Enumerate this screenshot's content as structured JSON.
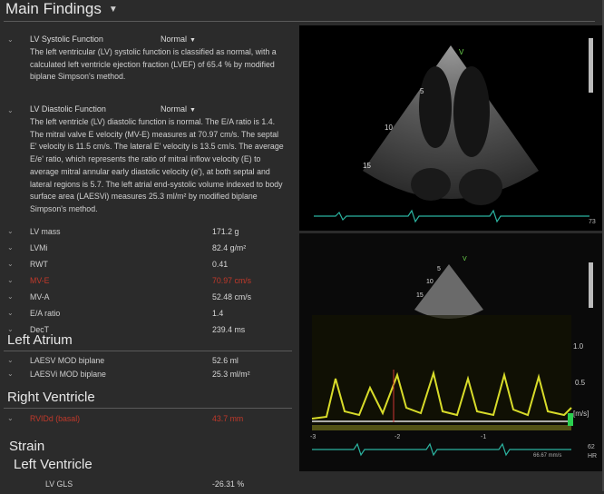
{
  "header": {
    "title": "Main Findings"
  },
  "lv_systolic": {
    "title": "LV Systolic Function",
    "status": "Normal",
    "text": "The left ventricular (LV) systolic function is classified as normal, with a calculated left ventricle ejection fraction (LVEF) of 65.4 % by modified biplane Simpson's method."
  },
  "lv_diastolic": {
    "title": "LV Diastolic Function",
    "status": "Normal",
    "text": "The left ventricle (LV) diastolic function is normal. The E/A ratio is 1.4. The mitral valve E velocity (MV-E) measures at 70.97 cm/s. The septal E' velocity is 11.5 cm/s. The lateral E' velocity is 13.5 cm/s. The average E/e' ratio, which represents the ratio of mitral inflow velocity (E) to average mitral annular early diastolic velocity (e'), at both septal and lateral regions is 5.7. The left atrial end-systolic volume indexed to body surface area (LAESVi) measures 25.3 ml/m² by modified biplane Simpson's method."
  },
  "measurements": [
    {
      "label": "LV mass",
      "value": "171.2 g",
      "abnormal": false
    },
    {
      "label": "LVMi",
      "value": "82.4 g/m²",
      "abnormal": false
    },
    {
      "label": "RWT",
      "value": "0.41",
      "abnormal": false
    },
    {
      "label": "MV-E",
      "value": "70.97 cm/s",
      "abnormal": true
    },
    {
      "label": "MV-A",
      "value": "52.48 cm/s",
      "abnormal": false
    },
    {
      "label": "E/A ratio",
      "value": "1.4",
      "abnormal": false
    },
    {
      "label": "DecT",
      "value": "239.4 ms",
      "abnormal": false
    }
  ],
  "left_atrium": {
    "title": "Left Atrium",
    "rows": [
      {
        "label": "LAESV MOD biplane",
        "value": "52.6 ml"
      },
      {
        "label": "LAESVi MOD biplane",
        "value": "25.3 ml/m²"
      }
    ]
  },
  "right_ventricle": {
    "title": "Right Ventricle",
    "rows": [
      {
        "label": "RVIDd (basal)",
        "value": "43.7 mm",
        "abnormal": true
      }
    ]
  },
  "strain": {
    "title": "Strain",
    "subtitle": "Left Ventricle",
    "rows": [
      {
        "label": "LV GLS",
        "value": "-26.31 %"
      }
    ]
  },
  "echo_top": {
    "depth_marks": [
      "5",
      "10",
      "15"
    ],
    "marker": "V",
    "frame": "73"
  },
  "echo_bottom": {
    "thumb_depth_marks": [
      "5",
      "10",
      "15"
    ],
    "thumb_marker": "V",
    "scale_labels": [
      "1.0",
      "0.5"
    ],
    "unit": "[m/s]",
    "time_labels": [
      "-3",
      "-2",
      "-1"
    ],
    "speed": "66.67 mm/s",
    "hr_value": "62",
    "hr_label": "HR"
  },
  "colors": {
    "background": "#2b2b2b",
    "abnormal": "#c0392b",
    "doppler": "#d8dc2a",
    "ecg": "#2bb3a0",
    "marker": "#6fd94f"
  },
  "icons": [
    "chevron-down-icon",
    "collapse-chevron-icon",
    "dropdown-caret-icon"
  ]
}
